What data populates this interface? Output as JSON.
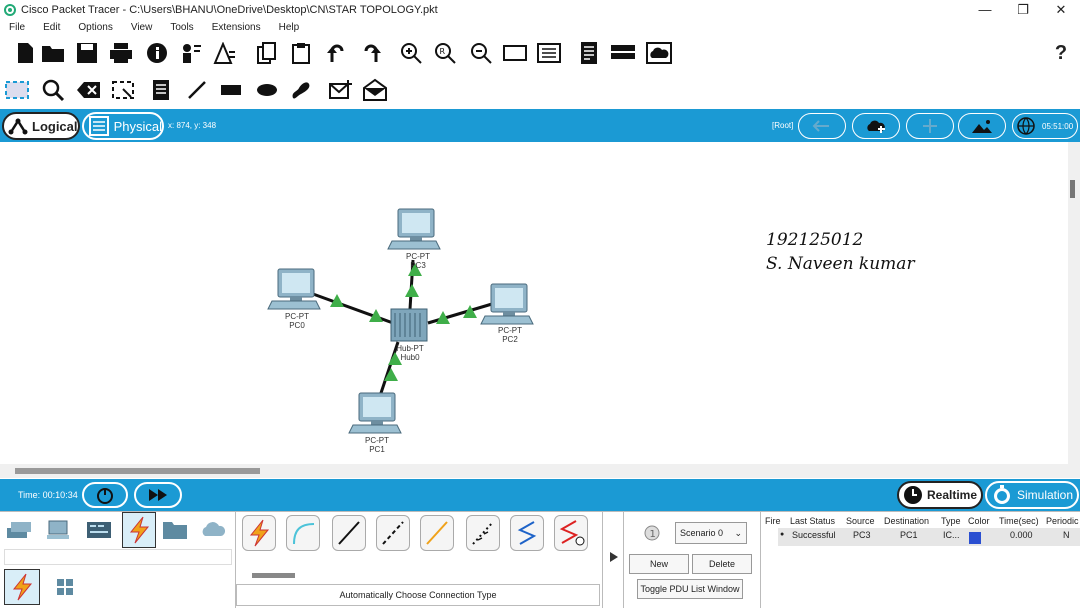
{
  "window": {
    "title": "Cisco Packet Tracer - C:\\Users\\BHANU\\OneDrive\\Desktop\\CN\\STAR TOPOLOGY.pkt",
    "minimize": "—",
    "maximize": "❐",
    "close": "✕"
  },
  "menu": [
    "File",
    "Edit",
    "Options",
    "View",
    "Tools",
    "Extensions",
    "Help"
  ],
  "toolbar": {
    "help": "?"
  },
  "modes": {
    "logical": "Logical",
    "physical": "Physical",
    "coords": "x: 874, y: 348",
    "root": "[Root]",
    "clock": "05:51:00"
  },
  "devices": [
    {
      "model": "PC-PT",
      "name": "PC0"
    },
    {
      "model": "PC-PT",
      "name": "PC1"
    },
    {
      "model": "PC-PT",
      "name": "PC2"
    },
    {
      "model": "PC-PT",
      "name": "PC3"
    },
    {
      "model": "Hub-PT",
      "name": "Hub0"
    }
  ],
  "note": {
    "line1": "192125012",
    "line2": "S. Naveen kumar"
  },
  "timebar": {
    "time": "Time: 00:10:34",
    "realtime": "Realtime",
    "simulation": "Simulation"
  },
  "bottom": {
    "connection_hint": "Automatically Choose Connection Type",
    "scenario": "Scenario 0",
    "new": "New",
    "delete": "Delete",
    "toggle": "Toggle PDU List Window"
  },
  "pdu_table": {
    "headers": [
      "Fire",
      "Last Status",
      "Source",
      "Destination",
      "Type",
      "Color",
      "Time(sec)",
      "Periodic"
    ],
    "rows": [
      {
        "fire": "●",
        "status": "Successful",
        "source": "PC3",
        "destination": "PC1",
        "type": "IC...",
        "color": "#2a4fd1",
        "time": "0.000",
        "periodic": "N"
      }
    ]
  },
  "colors": {
    "accent": "#1b9ad4",
    "link_ok": "#3fae49"
  }
}
